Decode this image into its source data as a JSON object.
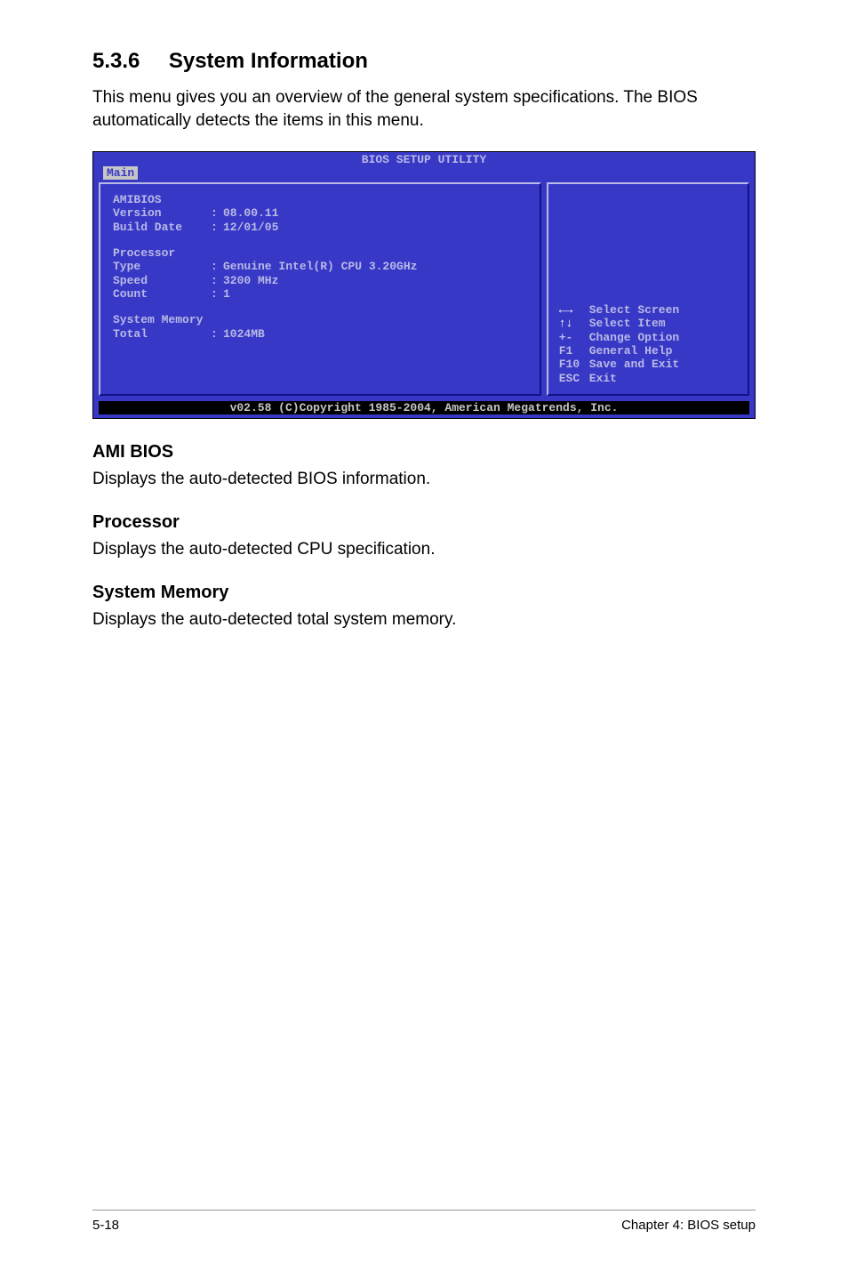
{
  "section": {
    "num": "5.3.6",
    "title": "System Information"
  },
  "intro": "This menu gives you an overview of the general system specifications. The BIOS automatically detects the items in this menu.",
  "bios": {
    "title": "BIOS SETUP UTILITY",
    "tab": "Main",
    "groups": {
      "amibios": {
        "header": "AMIBIOS",
        "version_label": "Version",
        "version_value": "08.00.11",
        "builddate_label": "Build Date",
        "builddate_value": "12/01/05"
      },
      "processor": {
        "header": "Processor",
        "type_label": "Type",
        "type_value": "Genuine Intel(R) CPU 3.20GHz",
        "speed_label": "Speed",
        "speed_value": "3200 MHz",
        "count_label": "Count",
        "count_value": "1"
      },
      "memory": {
        "header": "System Memory",
        "total_label": "Total",
        "total_value": "1024MB"
      }
    },
    "help": {
      "select_screen": "Select Screen",
      "select_item": "Select Item",
      "change_option_key": "+-",
      "change_option": "Change Option",
      "general_help_key": "F1",
      "general_help": "General Help",
      "save_exit_key": "F10",
      "save_exit": "Save and Exit",
      "exit_key": "ESC",
      "exit": "Exit"
    },
    "footer": "v02.58 (C)Copyright 1985-2004, American Megatrends, Inc."
  },
  "sub": {
    "amibios": {
      "title": "AMI BIOS",
      "text": "Displays the auto-detected BIOS information."
    },
    "processor": {
      "title": "Processor",
      "text": "Displays the auto-detected CPU specification."
    },
    "memory": {
      "title": "System Memory",
      "text": "Displays the auto-detected total system memory."
    }
  },
  "page_footer": {
    "left": "5-18",
    "right": "Chapter 4: BIOS setup"
  }
}
